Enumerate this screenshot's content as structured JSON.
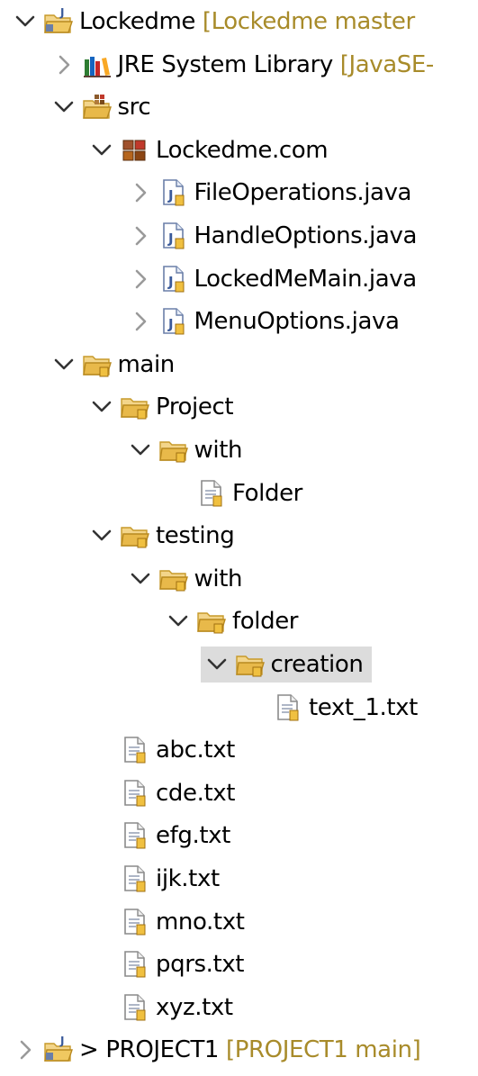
{
  "tree": {
    "rows": [
      {
        "label": "Lockedme",
        "decoration": "[Lockedme master",
        "prefix": "",
        "icon": "java-project-icon",
        "toggle": "expanded",
        "level": 0
      },
      {
        "label": "JRE System Library",
        "decoration": "[JavaSE-",
        "prefix": "",
        "icon": "library-icon",
        "toggle": "collapsed",
        "level": 1
      },
      {
        "label": "src",
        "decoration": "",
        "prefix": "",
        "icon": "source-folder-icon",
        "toggle": "expanded",
        "level": 1
      },
      {
        "label": "Lockedme.com",
        "decoration": "",
        "prefix": "",
        "icon": "package-icon",
        "toggle": "expanded",
        "level": 2
      },
      {
        "label": "FileOperations.java",
        "decoration": "",
        "prefix": "",
        "icon": "java-file-icon",
        "toggle": "collapsed",
        "level": 3
      },
      {
        "label": "HandleOptions.java",
        "decoration": "",
        "prefix": "",
        "icon": "java-file-icon",
        "toggle": "collapsed",
        "level": 3
      },
      {
        "label": "LockedMeMain.java",
        "decoration": "",
        "prefix": "",
        "icon": "java-file-icon",
        "toggle": "collapsed",
        "level": 3
      },
      {
        "label": "MenuOptions.java",
        "decoration": "",
        "prefix": "",
        "icon": "java-file-icon",
        "toggle": "collapsed",
        "level": 3
      },
      {
        "label": "main",
        "decoration": "",
        "prefix": "",
        "icon": "folder-icon",
        "toggle": "expanded",
        "level": 1
      },
      {
        "label": "Project",
        "decoration": "",
        "prefix": "",
        "icon": "folder-icon",
        "toggle": "expanded",
        "level": 2
      },
      {
        "label": "with",
        "decoration": "",
        "prefix": "",
        "icon": "folder-icon",
        "toggle": "expanded",
        "level": 3
      },
      {
        "label": "Folder",
        "decoration": "",
        "prefix": "",
        "icon": "text-file-icon",
        "toggle": "none",
        "level": 4
      },
      {
        "label": "testing",
        "decoration": "",
        "prefix": "",
        "icon": "folder-icon",
        "toggle": "expanded",
        "level": 2
      },
      {
        "label": "with",
        "decoration": "",
        "prefix": "",
        "icon": "folder-icon",
        "toggle": "expanded",
        "level": 3
      },
      {
        "label": "folder",
        "decoration": "",
        "prefix": "",
        "icon": "folder-icon",
        "toggle": "expanded",
        "level": 4
      },
      {
        "label": "creation",
        "decoration": "",
        "prefix": "",
        "icon": "folder-icon",
        "toggle": "expanded",
        "level": 5,
        "selected": true
      },
      {
        "label": "text_1.txt",
        "decoration": "",
        "prefix": "",
        "icon": "text-file-icon",
        "toggle": "none",
        "level": 6
      },
      {
        "label": "abc.txt",
        "decoration": "",
        "prefix": "",
        "icon": "text-file-icon",
        "toggle": "none",
        "level": 2
      },
      {
        "label": "cde.txt",
        "decoration": "",
        "prefix": "",
        "icon": "text-file-icon",
        "toggle": "none",
        "level": 2
      },
      {
        "label": "efg.txt",
        "decoration": "",
        "prefix": "",
        "icon": "text-file-icon",
        "toggle": "none",
        "level": 2
      },
      {
        "label": "ijk.txt",
        "decoration": "",
        "prefix": "",
        "icon": "text-file-icon",
        "toggle": "none",
        "level": 2
      },
      {
        "label": "mno.txt",
        "decoration": "",
        "prefix": "",
        "icon": "text-file-icon",
        "toggle": "none",
        "level": 2
      },
      {
        "label": "pqrs.txt",
        "decoration": "",
        "prefix": "",
        "icon": "text-file-icon",
        "toggle": "none",
        "level": 2
      },
      {
        "label": "xyz.txt",
        "decoration": "",
        "prefix": "",
        "icon": "text-file-icon",
        "toggle": "none",
        "level": 2
      },
      {
        "label": "PROJECT1",
        "decoration": "[PROJECT1 main]",
        "prefix": ">",
        "icon": "java-project-icon",
        "toggle": "collapsed",
        "level": 0
      }
    ]
  },
  "colors": {
    "decoration": "#a88b2a",
    "selection": "#dcdcdc",
    "chevron_expanded": "#333333",
    "chevron_collapsed": "#9a9a9a",
    "folder": "#e8b94a"
  }
}
